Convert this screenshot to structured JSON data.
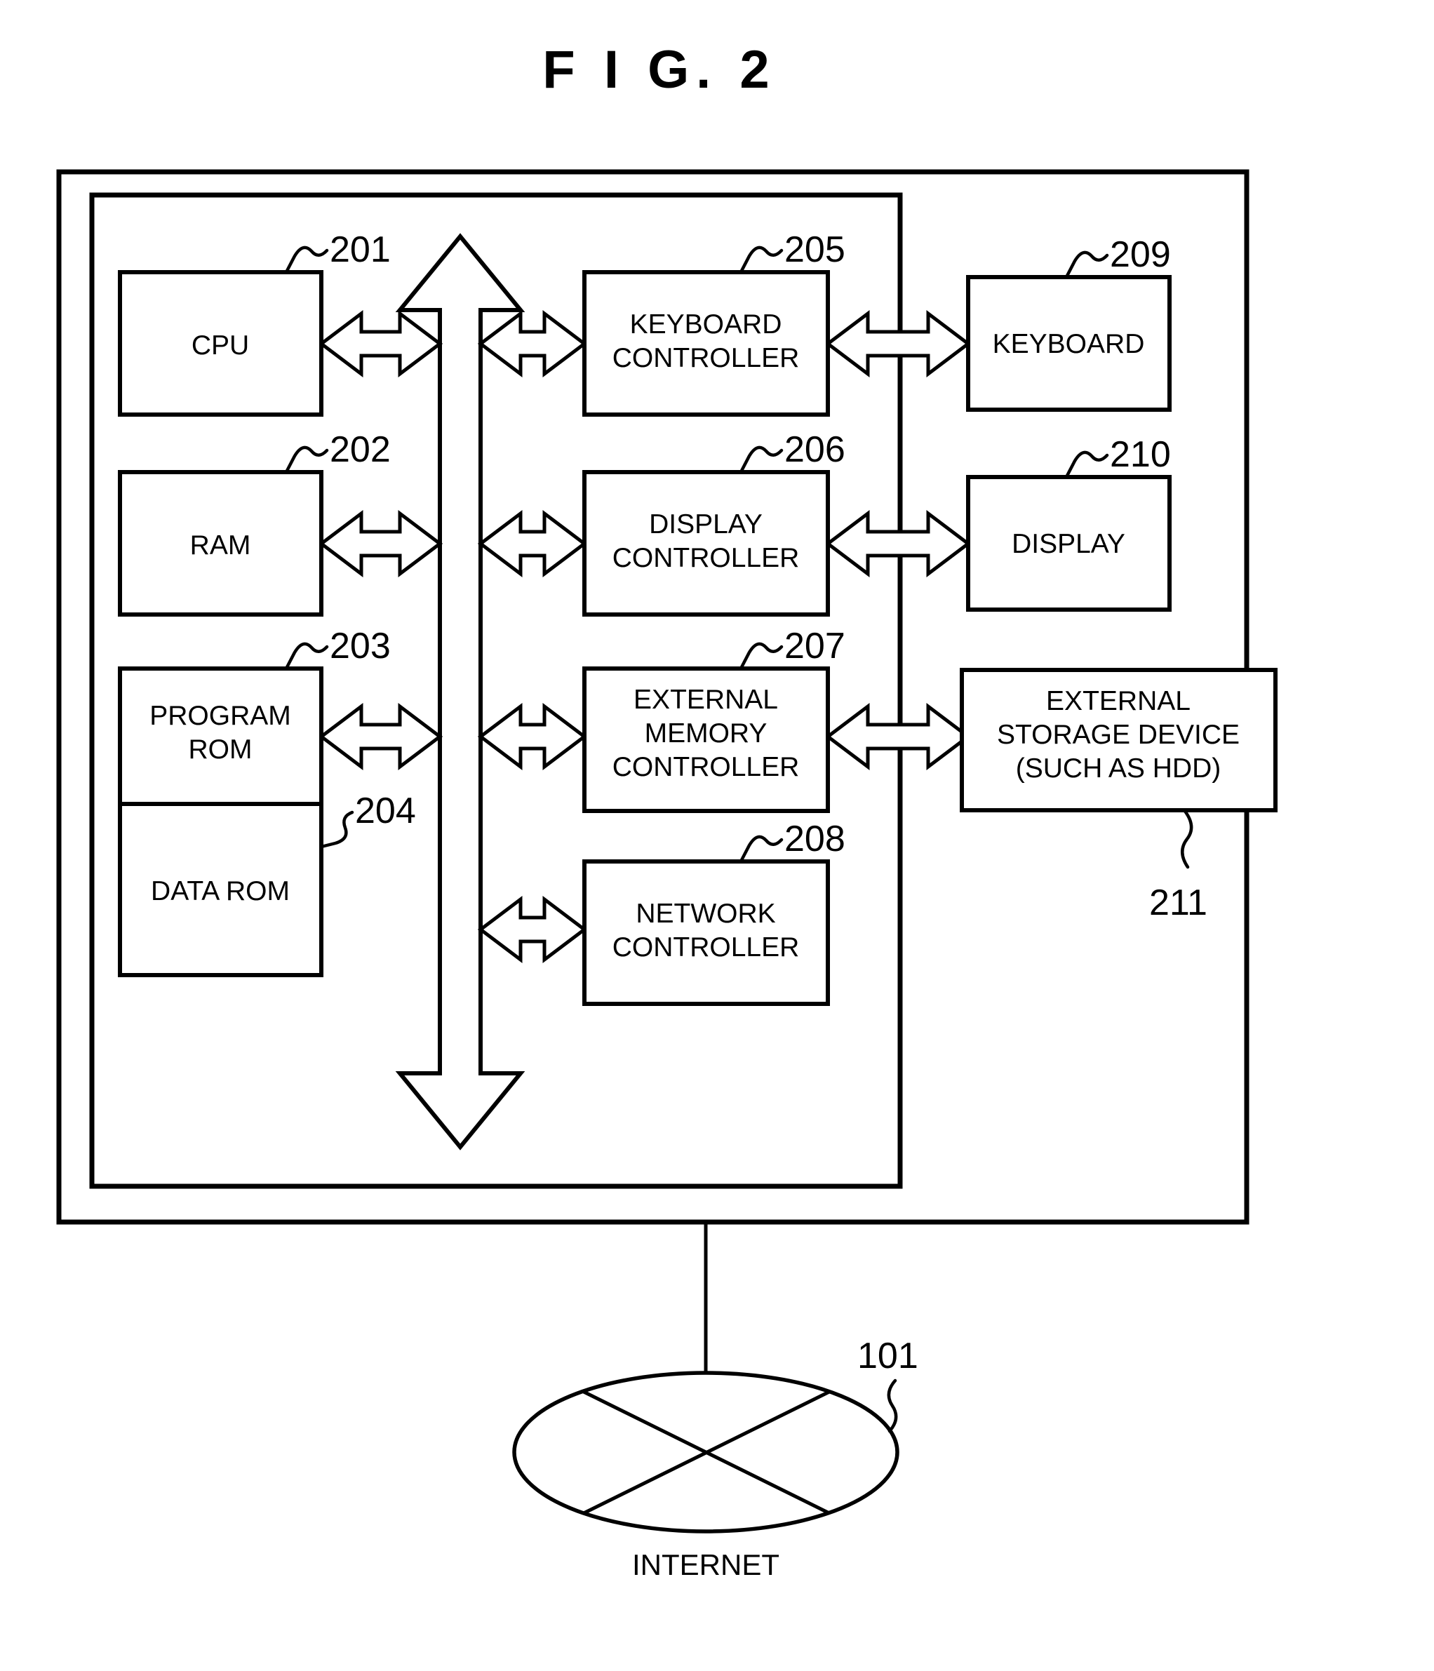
{
  "figure": {
    "title": "F I G.  2"
  },
  "blocks": {
    "cpu": {
      "label_lines": [
        "CPU"
      ],
      "ref": "201"
    },
    "ram": {
      "label_lines": [
        "RAM"
      ],
      "ref": "202"
    },
    "program_rom": {
      "label_lines": [
        "PROGRAM",
        "ROM"
      ],
      "ref": "203"
    },
    "data_rom": {
      "label_lines": [
        "DATA ROM"
      ],
      "ref": "204"
    },
    "keyboard_ctrl": {
      "label_lines": [
        "KEYBOARD",
        "CONTROLLER"
      ],
      "ref": "205"
    },
    "display_ctrl": {
      "label_lines": [
        "DISPLAY",
        "CONTROLLER"
      ],
      "ref": "206"
    },
    "ext_mem_ctrl": {
      "label_lines": [
        "EXTERNAL",
        "MEMORY",
        "CONTROLLER"
      ],
      "ref": "207"
    },
    "network_ctrl": {
      "label_lines": [
        "NETWORK",
        "CONTROLLER"
      ],
      "ref": "208"
    },
    "keyboard": {
      "label_lines": [
        "KEYBOARD"
      ],
      "ref": "209"
    },
    "display": {
      "label_lines": [
        "DISPLAY"
      ],
      "ref": "210"
    },
    "ext_storage": {
      "label_lines": [
        "EXTERNAL",
        "STORAGE DEVICE",
        "(SUCH AS HDD)"
      ],
      "ref": "211"
    },
    "internet": {
      "label_lines": [
        "INTERNET"
      ],
      "ref": "101"
    }
  },
  "colors": {
    "stroke": "#000000",
    "fill": "#ffffff"
  }
}
